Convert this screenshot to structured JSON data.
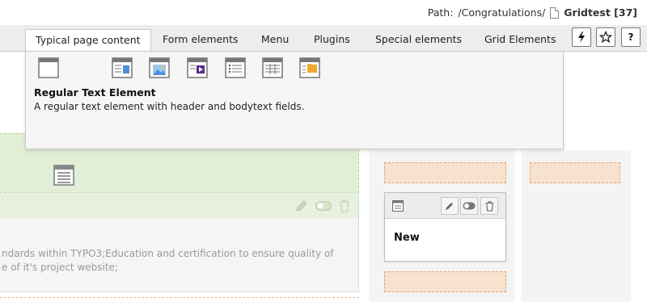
{
  "path": {
    "label": "Path:",
    "value": "/Congratulations/",
    "page": "Gridtest [37]"
  },
  "tabs": [
    {
      "label": "Typical page content"
    },
    {
      "label": "Form elements"
    },
    {
      "label": "Menu"
    },
    {
      "label": "Plugins"
    },
    {
      "label": "Special elements"
    },
    {
      "label": "Grid Elements"
    }
  ],
  "toolbar_icons": [
    "bolt-icon",
    "star-icon",
    "help-icon"
  ],
  "help_label": "?",
  "wizard": {
    "icons": [
      "text-icon",
      "text-image-icon",
      "image-icon",
      "text-media-icon",
      "bullets-icon",
      "table-icon",
      "uploads-icon"
    ],
    "title": "Regular Text Element",
    "description": "A regular text element with header and bodytext fields."
  },
  "content_text": {
    "line1": "ndards within TYPO3;Education and certification to ensure quality of",
    "line2": "e of it's project website;"
  },
  "content_element": {
    "title": "New"
  },
  "colors": {
    "drop_zone": "#f7e1cf",
    "green_zone": "#e3eed7",
    "media_purple": "#5b2a8a",
    "image_blue": "#4a90d9"
  }
}
